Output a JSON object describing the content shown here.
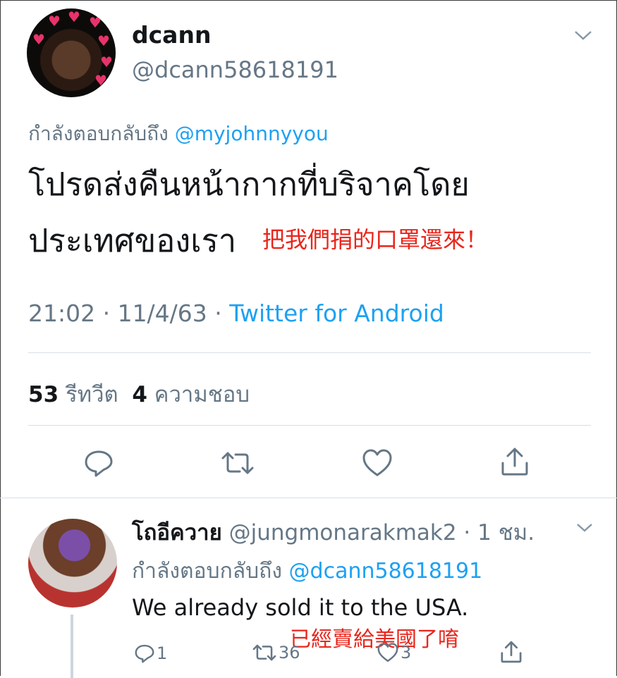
{
  "main_tweet": {
    "display_name": "dcann",
    "handle": "@dcann58618191",
    "replying_prefix": "กำลังตอบกลับถึง",
    "replying_to": "@myjohnnyyou",
    "text_line1": "โปรดส่งคืนหน้ากากที่บริจาคโดย",
    "text_line2": "ประเทศของเรา",
    "overlay_translation": "把我們捐的口罩還來！",
    "timestamp": "21:02 · 11/4/63 · ",
    "source": "Twitter for Android",
    "retweets_count": "53",
    "retweets_label": "รีทวีต",
    "likes_count": "4",
    "likes_label": "ความชอบ"
  },
  "reply_tweet": {
    "display_name": "โถอีควาย",
    "handle_time": "@jungmonarakmak2 · 1 ชม.",
    "replying_prefix": "กำลังตอบกลับถึง",
    "replying_to": "@dcann58618191",
    "text": "We already sold it to the USA.",
    "overlay_translation": "已經賣給美國了唷",
    "reply_count": "1",
    "retweet_count": "36",
    "like_count": "3"
  },
  "icons": [
    "chevron-down-icon",
    "reply-icon",
    "retweet-icon",
    "like-icon",
    "share-icon"
  ],
  "colors": {
    "accent": "#1da1f2",
    "secondary_text": "#657786",
    "overlay_red": "#e8261c"
  }
}
